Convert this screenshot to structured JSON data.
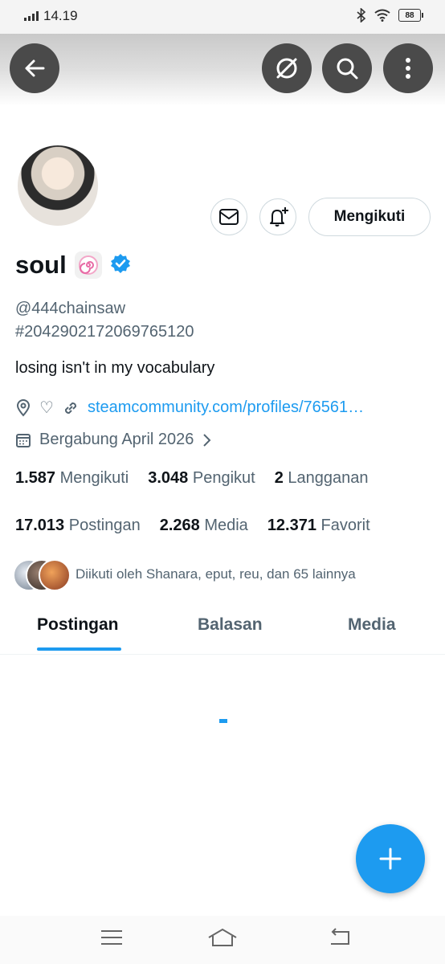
{
  "status_bar": {
    "time": "14.19",
    "battery": "88"
  },
  "header": {
    "back": "back-arrow-icon",
    "translate_icon": "no-translate-icon",
    "search_icon": "search-icon",
    "more_icon": "more-vertical-icon"
  },
  "profile": {
    "display_name": "soul",
    "emoji": "🍥",
    "verified": true,
    "handle": "@444chainsaw",
    "id_line": "#2042902172069765120",
    "bio": "losing isn't in my vocabulary",
    "location_icon": "location-pin-icon",
    "heart": "♡",
    "website": "steamcommunity.com/profiles/76561…",
    "joined": "Bergabung April 2026",
    "following_button": "Mengikuti"
  },
  "stats": {
    "following_count": "1.587",
    "following_label": "Mengikuti",
    "followers_count": "3.048",
    "followers_label": "Pengikut",
    "subs_count": "2",
    "subs_label": "Langganan",
    "posts_count": "17.013",
    "posts_label": "Postingan",
    "media_count": "2.268",
    "media_label": "Media",
    "fav_count": "12.371",
    "fav_label": "Favorit"
  },
  "followed_by": "Diikuti oleh Shanara, eput, reu, dan 65 lainnya",
  "tabs": [
    {
      "label": "Postingan",
      "active": true
    },
    {
      "label": "Balasan",
      "active": false
    },
    {
      "label": "Media",
      "active": false
    }
  ],
  "colors": {
    "accent": "#1d9bf0",
    "text": "#0f1419",
    "muted": "#536471"
  }
}
